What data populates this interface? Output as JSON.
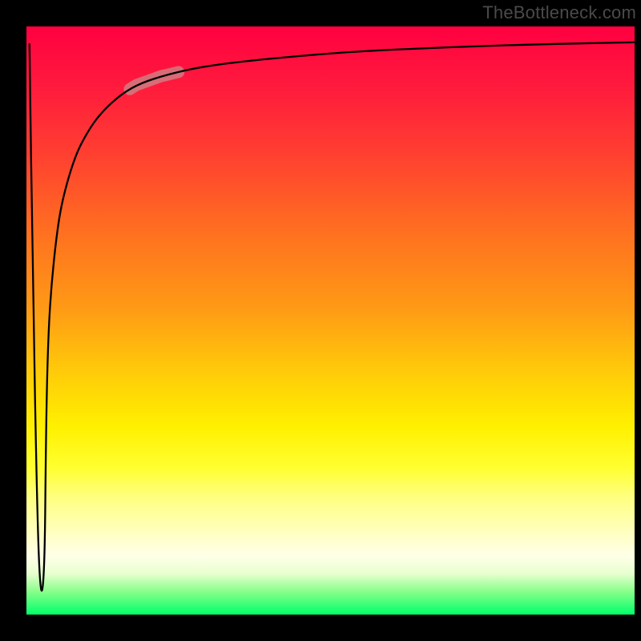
{
  "watermark": "TheBottleneck.com",
  "chart_data": {
    "type": "line",
    "title": "",
    "xlabel": "",
    "ylabel": "",
    "xlim": [
      0,
      100
    ],
    "ylim": [
      0,
      100
    ],
    "grid": false,
    "legend": false,
    "series": [
      {
        "name": "curve",
        "x": [
          0.5,
          1,
          1.8,
          2.4,
          3,
          3.2,
          3.5,
          4,
          5,
          6,
          8,
          10,
          12,
          15,
          18,
          22,
          28,
          35,
          45,
          55,
          70,
          85,
          100
        ],
        "y": [
          97,
          60,
          15,
          2,
          8,
          30,
          45,
          55,
          65,
          71,
          78,
          82,
          85,
          88,
          90,
          91.5,
          93,
          94,
          95,
          95.8,
          96.5,
          97,
          97.3
        ]
      }
    ],
    "highlight_segment": {
      "x_start": 17,
      "x_end": 25,
      "color": "#c98a8a"
    },
    "gradient_colors": {
      "top": "#ff0040",
      "mid_top": "#ff8a1a",
      "mid": "#fff000",
      "mid_bottom": "#ffff80",
      "bottom": "#00ff6a"
    }
  }
}
